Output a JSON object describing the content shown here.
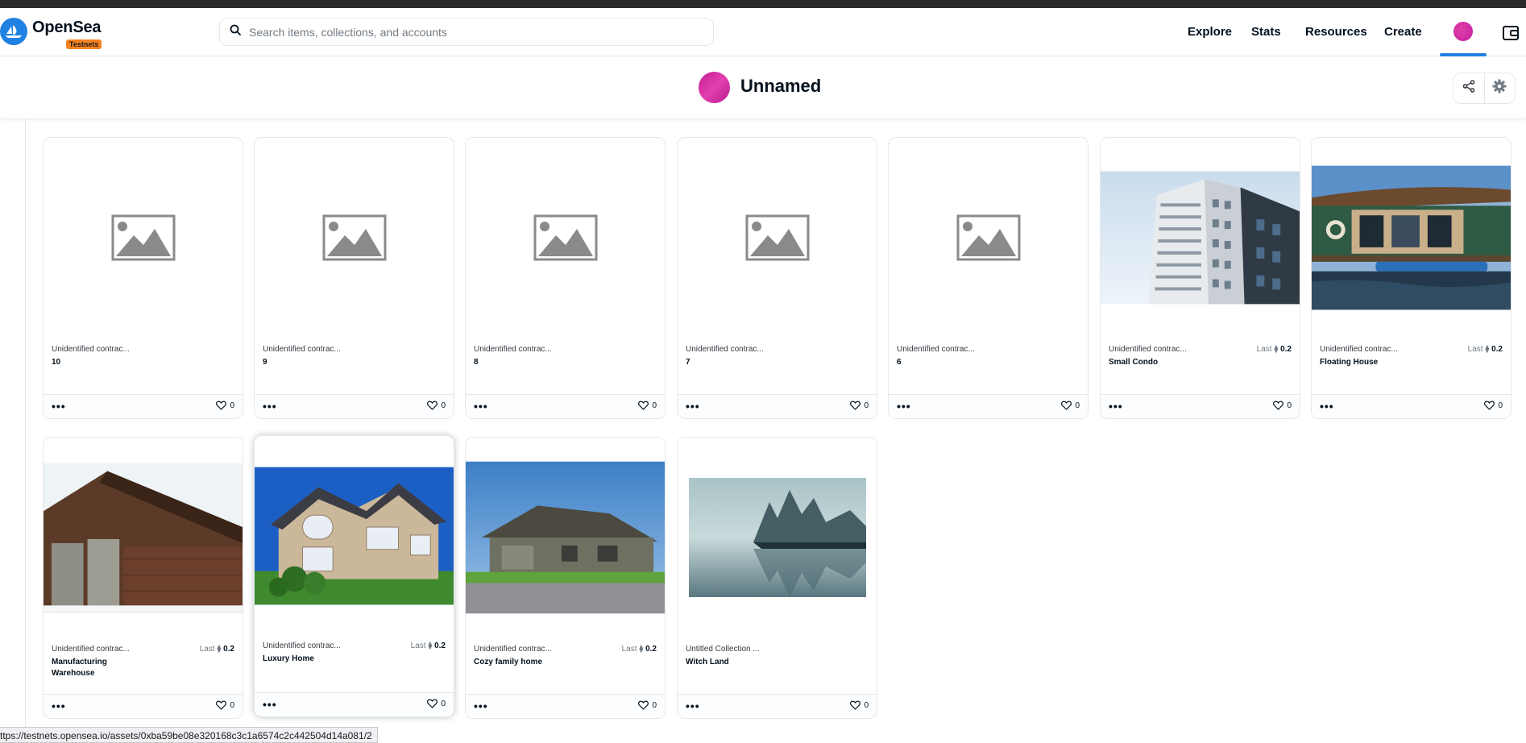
{
  "brand": {
    "name": "OpenSea",
    "badge": "Testnets",
    "accent": "#2081e2"
  },
  "search": {
    "placeholder": "Search items, collections, and accounts"
  },
  "nav": {
    "explore": "Explore",
    "stats": "Stats",
    "resources": "Resources",
    "create": "Create"
  },
  "profile": {
    "name": "Unnamed"
  },
  "cards": [
    {
      "collection": "Unidentified contrac...",
      "title": "10",
      "last_label": "",
      "last_price": "",
      "likes": "0",
      "image": "placeholder"
    },
    {
      "collection": "Unidentified contrac...",
      "title": "9",
      "last_label": "",
      "last_price": "",
      "likes": "0",
      "image": "placeholder"
    },
    {
      "collection": "Unidentified contrac...",
      "title": "8",
      "last_label": "",
      "last_price": "",
      "likes": "0",
      "image": "placeholder"
    },
    {
      "collection": "Unidentified contrac...",
      "title": "7",
      "last_label": "",
      "last_price": "",
      "likes": "0",
      "image": "placeholder"
    },
    {
      "collection": "Unidentified contrac...",
      "title": "6",
      "last_label": "",
      "last_price": "",
      "likes": "0",
      "image": "placeholder"
    },
    {
      "collection": "Unidentified contrac...",
      "title": "Small Condo",
      "last_label": "Last",
      "last_price": "0.2",
      "likes": "0",
      "image": "condo"
    },
    {
      "collection": "Unidentified contrac...",
      "title": "Floating House",
      "last_label": "Last",
      "last_price": "0.2",
      "likes": "0",
      "image": "houseboat"
    },
    {
      "collection": "Unidentified contrac...",
      "title": "Manufacturing Warehouse",
      "last_label": "Last",
      "last_price": "0.2",
      "likes": "0",
      "image": "warehouse"
    },
    {
      "collection": "Unidentified contrac...",
      "title": "Luxury Home",
      "last_label": "Last",
      "last_price": "0.2",
      "likes": "0",
      "image": "luxury"
    },
    {
      "collection": "Unidentified contrac...",
      "title": "Cozy family home",
      "last_label": "Last",
      "last_price": "0.2",
      "likes": "0",
      "image": "cozy"
    },
    {
      "collection": "Untitled Collection ...",
      "title": "Witch Land",
      "last_label": "",
      "last_price": "",
      "likes": "0",
      "image": "lake"
    }
  ],
  "status_url": "ttps://testnets.opensea.io/assets/0xba59be08e320168c3c1a6574c2c442504d14a081/2"
}
